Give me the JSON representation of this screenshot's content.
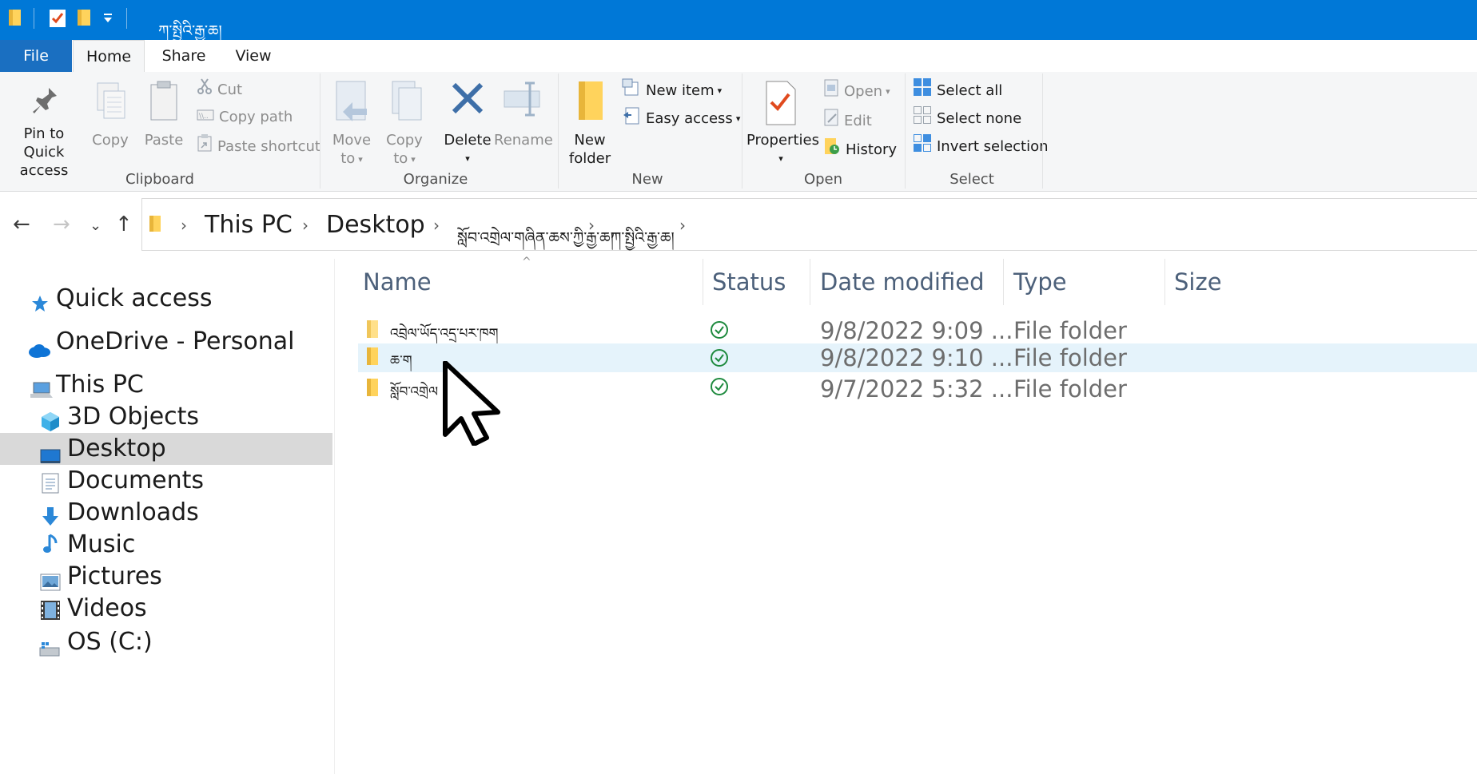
{
  "titlebar": {
    "title": "ཀ་སྤྱིའི་རྒྱ་ཆ།",
    "qat_icons": [
      "folder-icon",
      "properties-icon",
      "new-folder-icon",
      "customize-qat-icon"
    ]
  },
  "tabs": {
    "file": "File",
    "home": "Home",
    "share": "Share",
    "view": "View"
  },
  "ribbon": {
    "clipboard": {
      "label": "Clipboard",
      "pin_line1": "Pin to Quick",
      "pin_line2": "access",
      "copy": "Copy",
      "paste": "Paste",
      "cut": "Cut",
      "copy_path": "Copy path",
      "paste_shortcut": "Paste shortcut"
    },
    "organize": {
      "label": "Organize",
      "move_line1": "Move",
      "move_line2": "to",
      "copy_line1": "Copy",
      "copy_line2": "to",
      "delete": "Delete",
      "rename": "Rename"
    },
    "new": {
      "label": "New",
      "folder_line1": "New",
      "folder_line2": "folder",
      "new_item": "New item",
      "easy_access": "Easy access"
    },
    "open": {
      "label": "Open",
      "properties": "Properties",
      "open": "Open",
      "edit": "Edit",
      "history": "History"
    },
    "select": {
      "label": "Select",
      "select_all": "Select all",
      "select_none": "Select none",
      "invert": "Invert selection"
    }
  },
  "address": {
    "crumbs": [
      "This PC",
      "Desktop",
      "སློབ་འགྲེལ་གཞིན་ཆས་ཀྱི་རྒྱ་ཆ།",
      "ཀ་སྤྱིའི་རྒྱ་ཆ།"
    ]
  },
  "nav": {
    "quick_access": "Quick access",
    "onedrive": "OneDrive - Personal",
    "this_pc": "This PC",
    "objects_3d": "3D Objects",
    "desktop": "Desktop",
    "documents": "Documents",
    "downloads": "Downloads",
    "music": "Music",
    "pictures": "Pictures",
    "videos": "Videos",
    "os_c": "OS (C:)"
  },
  "columns": {
    "name": "Name",
    "status": "Status",
    "date": "Date modified",
    "type": "Type",
    "size": "Size"
  },
  "files": [
    {
      "name": "འབྲེལ་ཡོད་འདྲ་པར་ཁག",
      "date": "9/8/2022 9:09 ...",
      "type": "File folder",
      "selected": false
    },
    {
      "name": "ཆ་ག",
      "date": "9/8/2022 9:10 ...",
      "type": "File folder",
      "selected": true
    },
    {
      "name": "སློབ་འགྲེལ",
      "date": "9/7/2022 5:32 ...",
      "type": "File folder",
      "selected": false
    }
  ],
  "colors": {
    "titlebar": "#0078d7",
    "file_tab": "#1a6fc1",
    "selection": "#e5f3fb",
    "nav_selected": "#d9d9d9",
    "sync_ok": "#1e8a3e"
  }
}
